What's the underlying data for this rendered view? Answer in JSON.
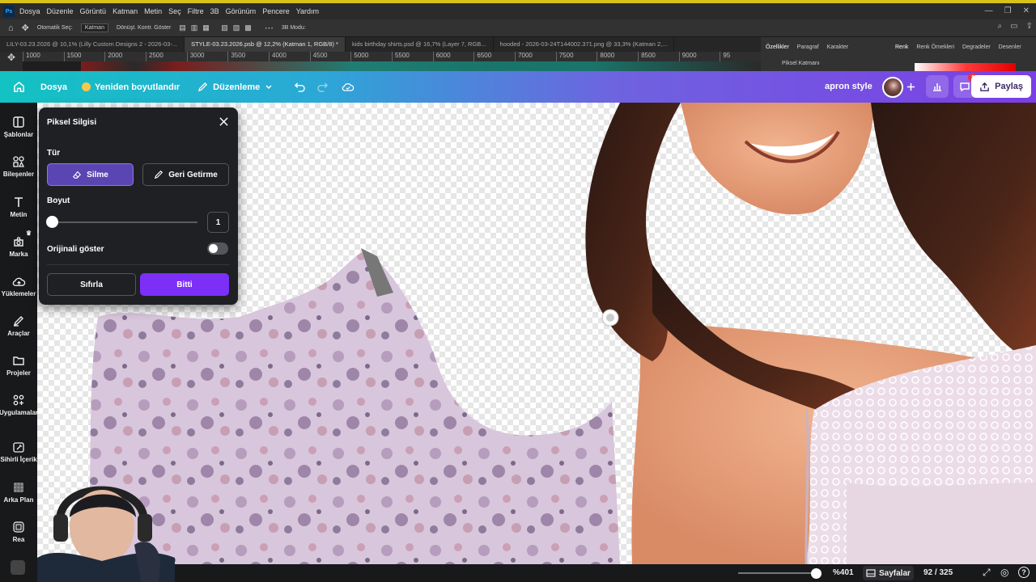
{
  "photoshop": {
    "menu": [
      "Dosya",
      "Düzenle",
      "Görüntü",
      "Katman",
      "Metin",
      "Seç",
      "Filtre",
      "3B",
      "Görünüm",
      "Pencere",
      "Yardım"
    ],
    "options": {
      "auto_select": "Otomatik Seç:",
      "layer_select": "Katman",
      "transform_controls": "Dönüşt. Kontr. Göster",
      "mode": "3B Modu:"
    },
    "tabs": [
      "LILY-03.23.2026 @ 10,1% (Lilly Custom Designs 2 - 2026-03-...",
      "STYLE-03.23.2026.psb @ 12,2% (Katman 1, RGB/8) *",
      "kids birthday shirts.psd @ 16,7% (Layer 7, RGB...",
      "hooded - 2026-03-24T144002.371.png @ 33,3% (Katman 2,..."
    ],
    "ruler": [
      "1000",
      "1500",
      "2000",
      "2500",
      "3000",
      "3500",
      "4000",
      "4500",
      "5000",
      "5500",
      "6000",
      "6500",
      "7000",
      "7500",
      "8000",
      "8500",
      "9000",
      "95"
    ],
    "panel_tabs": [
      "Özellikler",
      "Paragraf",
      "Karakter"
    ],
    "panel_sub": "Piksel Katmanı",
    "color_tabs": [
      "Renk",
      "Renk Örnekleri",
      "Degradeler",
      "Desenler"
    ],
    "colors": {
      "accent": "#31a8ff",
      "bg": "#2b2b2b"
    }
  },
  "canva": {
    "header": {
      "file": "Dosya",
      "resize": "Yeniden boyutlandır",
      "edit": "Düzenleme",
      "design_name": "apron style",
      "share": "Paylaş",
      "notification_count": "1"
    },
    "sidebar": [
      {
        "label": "Şablonlar",
        "icon": "templates-icon"
      },
      {
        "label": "Bileşenler",
        "icon": "elements-icon"
      },
      {
        "label": "Metin",
        "icon": "text-icon"
      },
      {
        "label": "Marka",
        "icon": "brand-icon"
      },
      {
        "label": "Yüklemeler",
        "icon": "upload-icon"
      },
      {
        "label": "Araçlar",
        "icon": "draw-icon"
      },
      {
        "label": "Projeler",
        "icon": "folder-icon"
      },
      {
        "label": "Uygulamalar",
        "icon": "apps-icon"
      },
      {
        "label": "Sihirli İçerik",
        "icon": "magic-icon"
      },
      {
        "label": "Arka Plan",
        "icon": "background-icon"
      },
      {
        "label": "Rea",
        "icon": "rea-icon"
      }
    ],
    "eraser_panel": {
      "title": "Piksel Silgisi",
      "type_label": "Tür",
      "erase": "Silme",
      "restore": "Geri Getirme",
      "size_label": "Boyut",
      "size_value": "1",
      "show_original": "Orijinali göster",
      "reset": "Sıfırla",
      "done": "Bitti"
    },
    "bottom": {
      "zoom": "%401",
      "pages": "Sayfalar",
      "page_count": "92 / 325"
    },
    "colors": {
      "purple": "#7b2ff7",
      "header_start": "#13c2c2",
      "header_end": "#7b3fe4"
    }
  }
}
